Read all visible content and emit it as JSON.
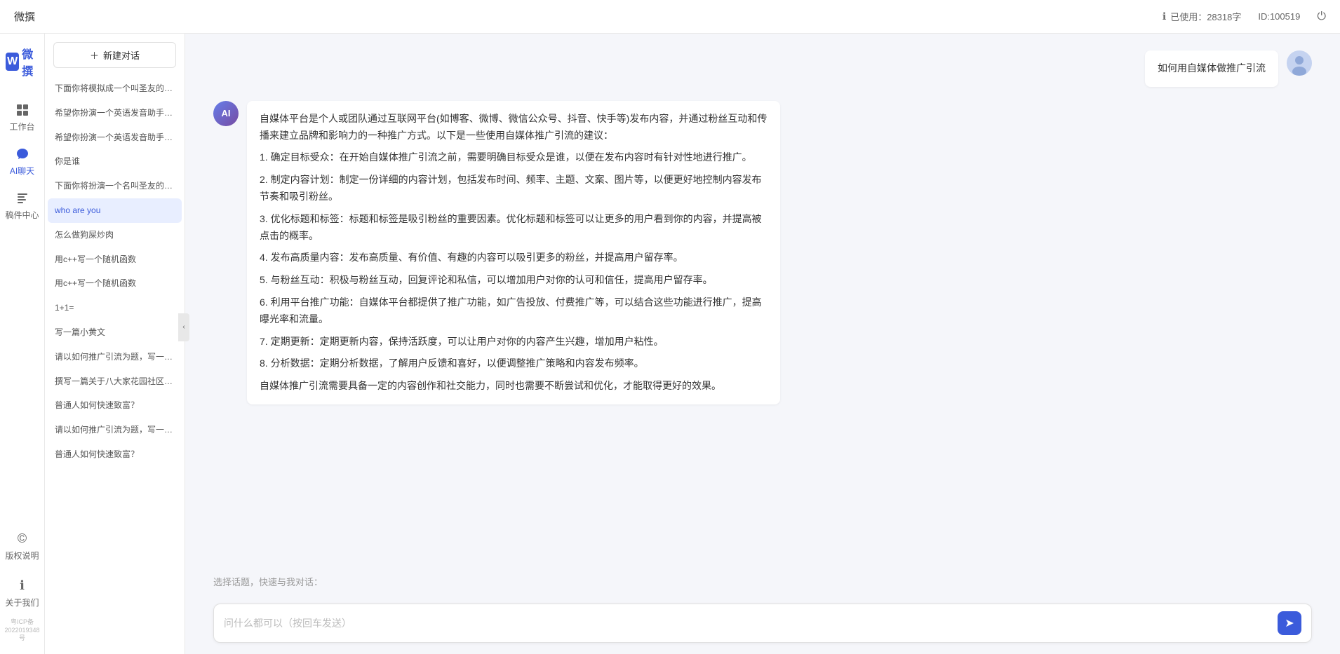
{
  "topbar": {
    "title": "微撰",
    "usage_label": "已使用：28318字",
    "id_label": "ID:100519",
    "usage_icon": "ℹ"
  },
  "sidebar_icons": {
    "logo_w": "W",
    "logo_text": "微撰",
    "nav_items": [
      {
        "id": "workbench",
        "icon": "⊞",
        "label": "工作台"
      },
      {
        "id": "ai-chat",
        "icon": "💬",
        "label": "AI聊天",
        "active": true
      },
      {
        "id": "components",
        "icon": "📦",
        "label": "稿件中心"
      }
    ],
    "bottom_items": [
      {
        "id": "copyright",
        "icon": "©",
        "label": "版权说明"
      },
      {
        "id": "about",
        "icon": "ℹ",
        "label": "关于我们"
      }
    ],
    "icp": "粤ICP备2022019348号"
  },
  "history": {
    "new_chat_label": "新建对话",
    "items": [
      {
        "id": 1,
        "text": "下面你将模拟成一个叫圣友的程序员，我说...",
        "active": false
      },
      {
        "id": 2,
        "text": "希望你扮演一个英语发音助手，我提供给你...",
        "active": false
      },
      {
        "id": 3,
        "text": "希望你扮演一个英语发音助手，我提供给你...",
        "active": false
      },
      {
        "id": 4,
        "text": "你是谁",
        "active": false
      },
      {
        "id": 5,
        "text": "下面你将扮演一个名叫圣友的医生",
        "active": false
      },
      {
        "id": 6,
        "text": "who are you",
        "active": true
      },
      {
        "id": 7,
        "text": "怎么做狗屎炒肉",
        "active": false
      },
      {
        "id": 8,
        "text": "用c++写一个随机函数",
        "active": false
      },
      {
        "id": 9,
        "text": "用c++写一个随机函数",
        "active": false
      },
      {
        "id": 10,
        "text": "1+1=",
        "active": false
      },
      {
        "id": 11,
        "text": "写一篇小黄文",
        "active": false
      },
      {
        "id": 12,
        "text": "请以如何推广引流为题，写一篇大纲",
        "active": false
      },
      {
        "id": 13,
        "text": "撰写一篇关于八大家花园社区一刻钟便民生...",
        "active": false
      },
      {
        "id": 14,
        "text": "普通人如何快速致富？",
        "active": false
      },
      {
        "id": 15,
        "text": "请以如何推广引流为题，写一篇大纲",
        "active": false
      },
      {
        "id": 16,
        "text": "普通人如何快速致富？",
        "active": false
      }
    ]
  },
  "chat": {
    "user_question": "如何用自媒体做推广引流",
    "ai_response": {
      "paragraphs": [
        "自媒体平台是个人或团队通过互联网平台(如博客、微博、微信公众号、抖音、快手等)发布内容，并通过粉丝互动和传播来建立品牌和影响力的一种推广方式。以下是一些使用自媒体推广引流的建议：",
        "1. 确定目标受众：在开始自媒体推广引流之前，需要明确目标受众是谁，以便在发布内容时有针对性地进行推广。",
        "2. 制定内容计划：制定一份详细的内容计划，包括发布时间、频率、主题、文案、图片等，以便更好地控制内容发布节奏和吸引粉丝。",
        "3. 优化标题和标签：标题和标签是吸引粉丝的重要因素。优化标题和标签可以让更多的用户看到你的内容，并提高被点击的概率。",
        "4. 发布高质量内容：发布高质量、有价值、有趣的内容可以吸引更多的粉丝，并提高用户留存率。",
        "5. 与粉丝互动：积极与粉丝互动，回复评论和私信，可以增加用户对你的认可和信任，提高用户留存率。",
        "6. 利用平台推广功能：自媒体平台都提供了推广功能，如广告投放、付费推广等，可以结合这些功能进行推广，提高曝光率和流量。",
        "7. 定期更新：定期更新内容，保持活跃度，可以让用户对你的内容产生兴趣，增加用户粘性。",
        "8. 分析数据：定期分析数据，了解用户反馈和喜好，以便调整推广策略和内容发布频率。",
        "自媒体推广引流需要具备一定的内容创作和社交能力，同时也需要不断尝试和优化，才能取得更好的效果。"
      ]
    },
    "quick_topics_label": "选择话题，快速与我对话：",
    "input_placeholder": "问什么都可以（按回车发送）"
  }
}
